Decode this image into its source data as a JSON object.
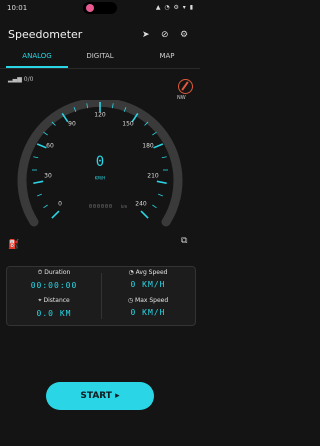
{
  "status_bar": {
    "time": "10:01",
    "icons_text": "▲ ◔ ⚙ ▾ ▮"
  },
  "header": {
    "title": "Speedometer"
  },
  "tabs": [
    {
      "label": "ANALOG",
      "active": true
    },
    {
      "label": "DIGITAL",
      "active": false
    },
    {
      "label": "MAP",
      "active": false
    }
  ],
  "gps": {
    "signal_text": "0/0"
  },
  "compass": {
    "label": "NW"
  },
  "gauge": {
    "labels": [
      "0",
      "30",
      "60",
      "90",
      "120",
      "150",
      "180",
      "210",
      "240"
    ],
    "speed": "0",
    "unit": "KM/H",
    "odometer": "000000",
    "odometer_unit": "km"
  },
  "stats": {
    "duration": {
      "label": "Duration",
      "value": "00:00:00"
    },
    "avg_speed": {
      "label": "Avg Speed",
      "value": "0 KM/H"
    },
    "distance": {
      "label": "Distance",
      "value": "0.0 KM"
    },
    "max_speed": {
      "label": "Max Speed",
      "value": "0 KM/H"
    }
  },
  "start_button": {
    "label": "START ▸"
  },
  "colors": {
    "accent": "#2ad6e6",
    "background": "#141414"
  }
}
